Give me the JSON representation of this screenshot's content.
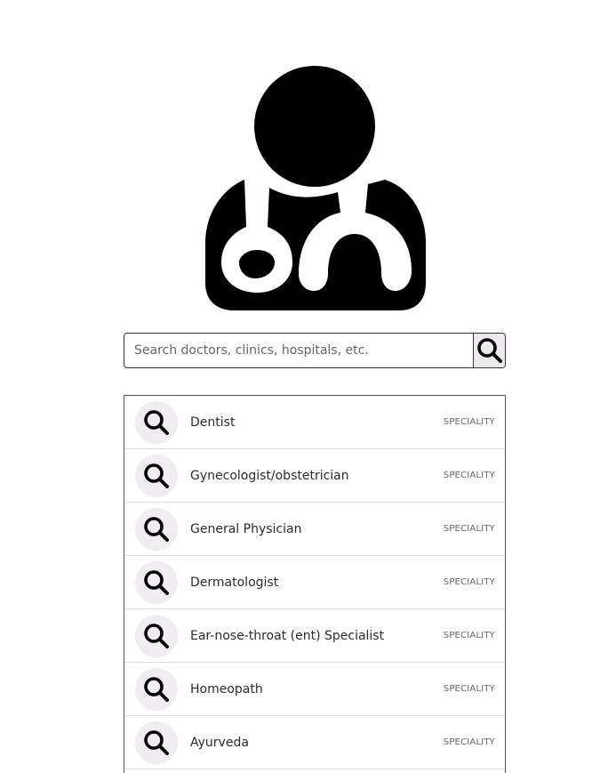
{
  "logo": {
    "icon": "doctor-stethoscope-icon"
  },
  "search": {
    "placeholder": "Search doctors, clinics, hospitals, etc.",
    "value": "",
    "button_icon": "search-icon"
  },
  "results": [
    {
      "label": "Dentist",
      "type": "SPECIALITY",
      "icon": "search-icon"
    },
    {
      "label": "Gynecologist/obstetrician",
      "type": "SPECIALITY",
      "icon": "search-icon"
    },
    {
      "label": "General Physician",
      "type": "SPECIALITY",
      "icon": "search-icon"
    },
    {
      "label": "Dermatologist",
      "type": "SPECIALITY",
      "icon": "search-icon"
    },
    {
      "label": "Ear-nose-throat (ent) Specialist",
      "type": "SPECIALITY",
      "icon": "search-icon"
    },
    {
      "label": "Homeopath",
      "type": "SPECIALITY",
      "icon": "search-icon"
    },
    {
      "label": "Ayurveda",
      "type": "SPECIALITY",
      "icon": "search-icon"
    }
  ],
  "colors": {
    "icon": "#000000",
    "icon_circle_bg": "#efedf0",
    "search_button_bg": "#ece9ec",
    "border": "#333333"
  }
}
